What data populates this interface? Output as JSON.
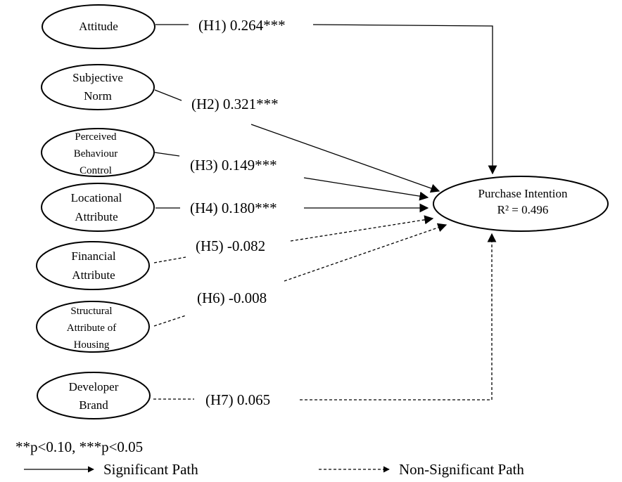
{
  "diagram": {
    "type": "structural-model",
    "outcome": {
      "title": "Purchase Intention",
      "r2_label": "R² = 0.496",
      "r2_value": 0.496
    },
    "constructs": [
      {
        "id": "attitude",
        "lines": [
          "Attitude"
        ]
      },
      {
        "id": "subjective-norm",
        "lines": [
          "Subjective",
          "Norm"
        ]
      },
      {
        "id": "perceived-behaviour-control",
        "lines": [
          "Perceived",
          "Behaviour",
          "Control"
        ]
      },
      {
        "id": "locational-attribute",
        "lines": [
          "Locational",
          "Attribute"
        ]
      },
      {
        "id": "financial-attribute",
        "lines": [
          "Financial",
          "Attribute"
        ]
      },
      {
        "id": "structural-attribute-of-housing",
        "lines": [
          "Structural",
          "Attribute of",
          "Housing"
        ]
      },
      {
        "id": "developer-brand",
        "lines": [
          "Developer",
          "Brand"
        ]
      }
    ],
    "paths": [
      {
        "hypothesis": "H1",
        "from": "attitude",
        "coefficient": 0.264,
        "label": "(H1) 0.264***",
        "significant": true
      },
      {
        "hypothesis": "H2",
        "from": "subjective-norm",
        "coefficient": 0.321,
        "label": "(H2) 0.321***",
        "significant": true
      },
      {
        "hypothesis": "H3",
        "from": "perceived-behaviour-control",
        "coefficient": 0.149,
        "label": "(H3) 0.149***",
        "significant": true
      },
      {
        "hypothesis": "H4",
        "from": "locational-attribute",
        "coefficient": 0.18,
        "label": "(H4) 0.180***",
        "significant": true
      },
      {
        "hypothesis": "H5",
        "from": "financial-attribute",
        "coefficient": -0.082,
        "label": "(H5) -0.082",
        "significant": false
      },
      {
        "hypothesis": "H6",
        "from": "structural-attribute-of-housing",
        "coefficient": -0.008,
        "label": "(H6) -0.008",
        "significant": false
      },
      {
        "hypothesis": "H7",
        "from": "developer-brand",
        "coefficient": 0.065,
        "label": "(H7) 0.065",
        "significant": false
      }
    ]
  },
  "legend": {
    "significance_note": "**p<0.10, ***p<0.05",
    "significant_label": "Significant Path",
    "non_significant_label": "Non-Significant Path"
  }
}
